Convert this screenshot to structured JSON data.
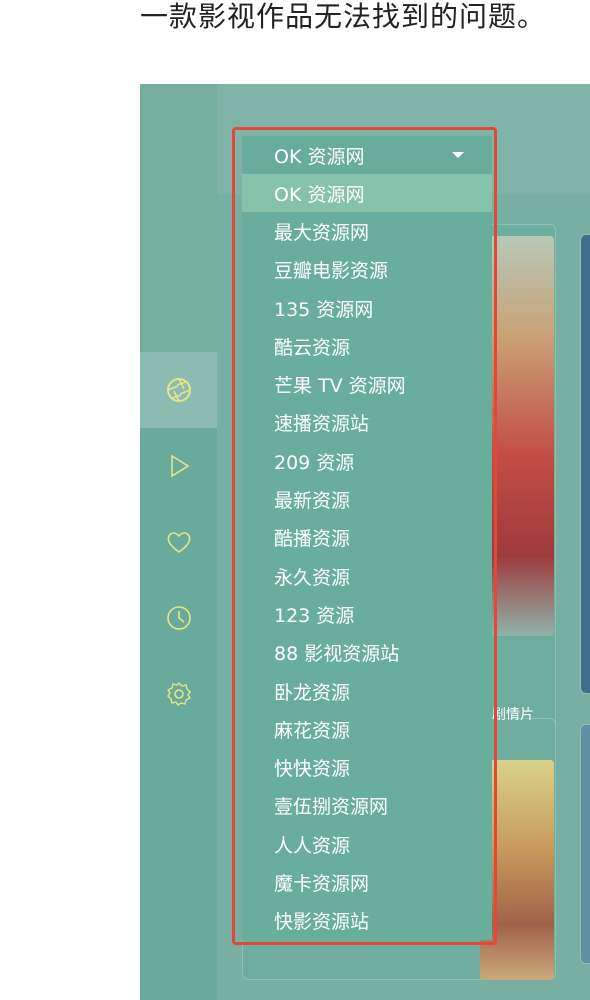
{
  "article": {
    "text": "一款影视作品无法找到的问题。"
  },
  "sidebar": {
    "items": [
      {
        "icon": "aperture-icon",
        "active": true
      },
      {
        "icon": "play-icon",
        "active": false
      },
      {
        "icon": "heart-icon",
        "active": false
      },
      {
        "icon": "clock-icon",
        "active": false
      },
      {
        "icon": "settings-icon",
        "active": false
      }
    ],
    "icon_color": "#e6e58a"
  },
  "source_select": {
    "selected": "OK 资源网",
    "options": [
      "OK 资源网",
      "最大资源网",
      "豆瓣电影资源",
      "135 资源网",
      "酷云资源",
      "芒果 TV 资源网",
      "速播资源站",
      "209 资源",
      "最新资源",
      "酷播资源",
      "永久资源",
      "123 资源",
      "88 影视资源站",
      "卧龙资源",
      "麻花资源",
      "快快资源",
      "壹伍捌资源网",
      "人人资源",
      "魔卡资源网",
      "快影资源站"
    ]
  },
  "card": {
    "caption": "剧情片"
  },
  "colors": {
    "highlight_border": "#e2473c",
    "app_bg": "#82b3a8",
    "selected_option_bg": "#86c2a9"
  }
}
